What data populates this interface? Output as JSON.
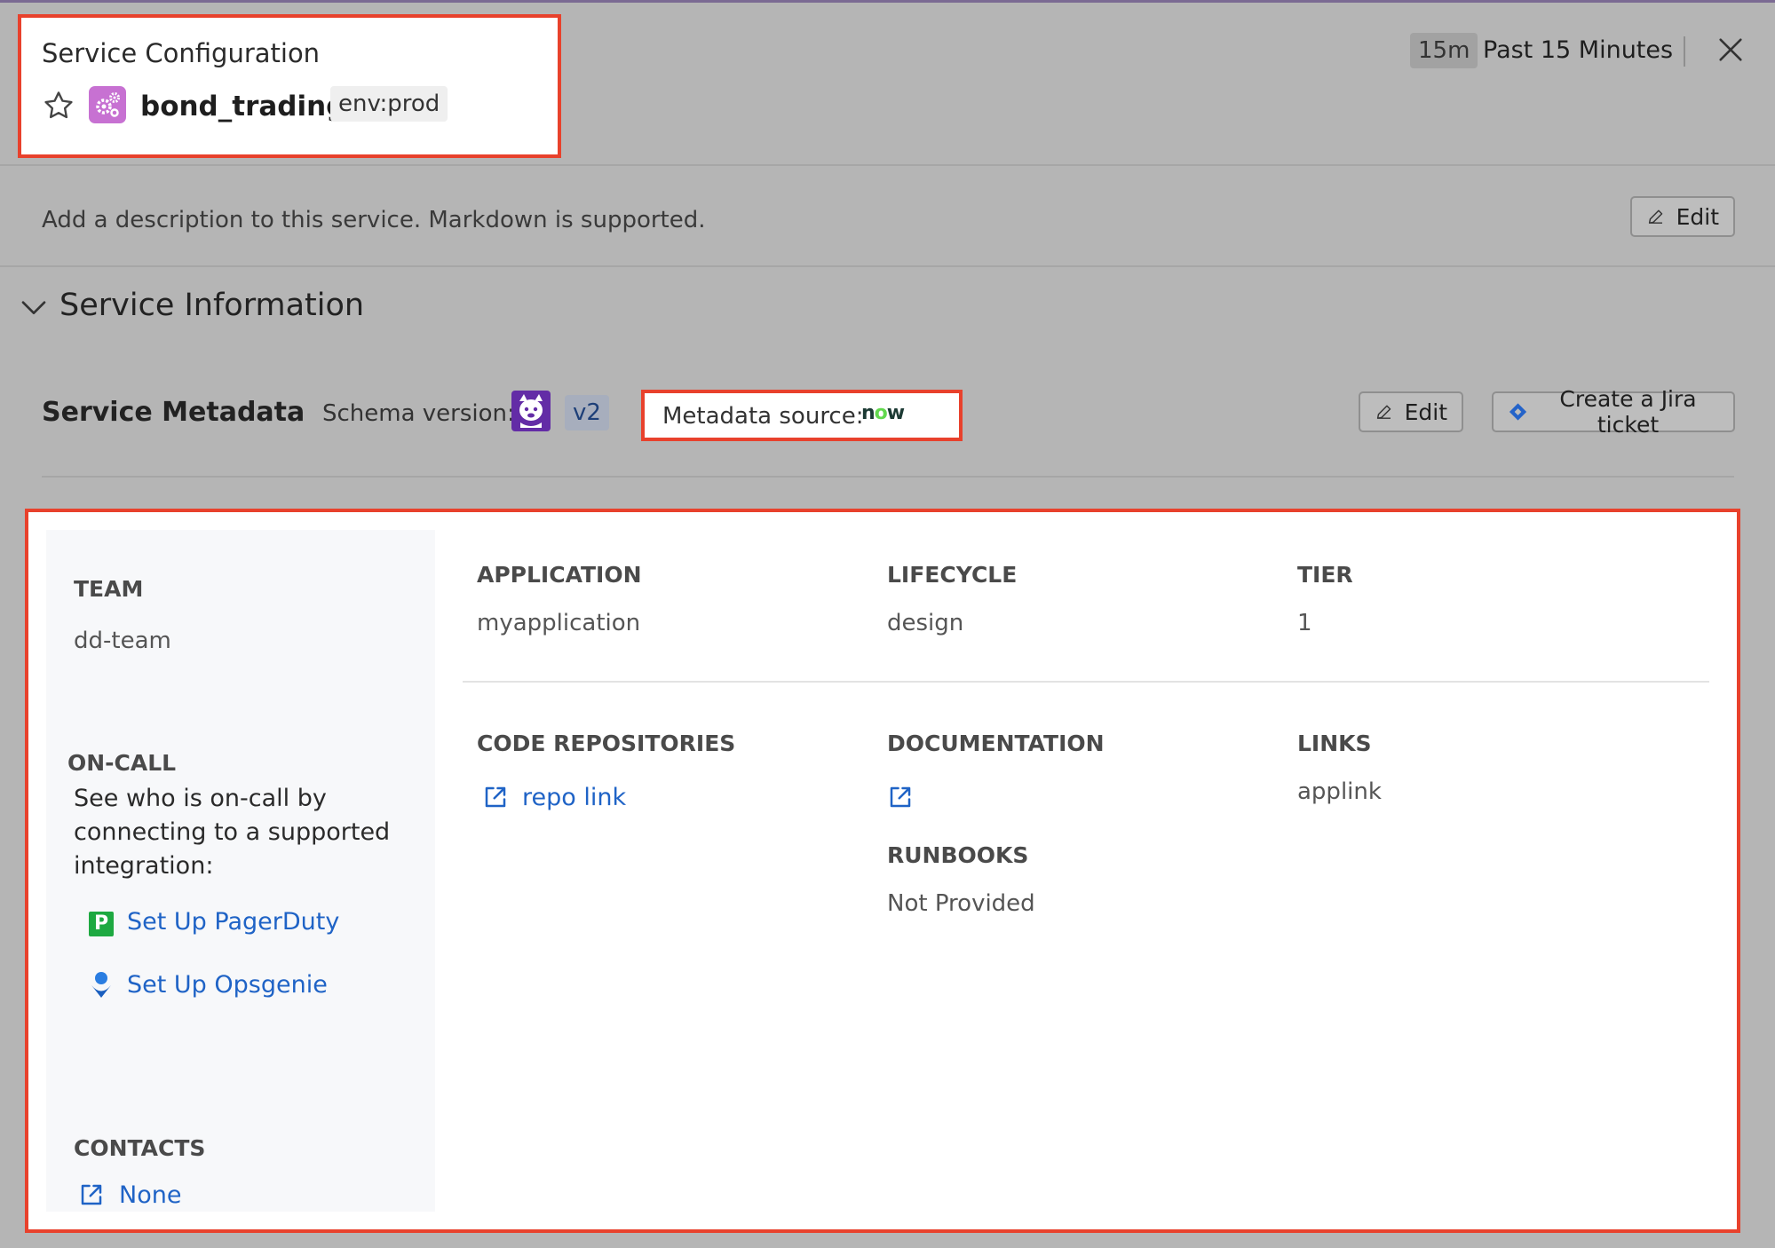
{
  "header": {
    "title": "Service Configuration",
    "service_name": "bond_trading",
    "env_tag": "env:prod",
    "time_badge": "15m",
    "time_label": "Past 15 Minutes"
  },
  "description": {
    "placeholder": "Add a description to this service. Markdown is supported.",
    "edit_label": "Edit"
  },
  "service_information": {
    "title": "Service Information",
    "metadata": {
      "label": "Service Metadata",
      "schema_label": "Schema version:",
      "schema_version": "v2",
      "source_label": "Metadata source:",
      "source_logo": "now",
      "edit_label": "Edit",
      "jira_label": "Create a Jira ticket"
    }
  },
  "panel": {
    "team": {
      "label": "TEAM",
      "value": "dd-team"
    },
    "oncall": {
      "label": "ON-CALL",
      "text": "See who is on-call by connecting to a supported integration:",
      "pagerduty_label": "Set Up PagerDuty",
      "opsgenie_label": "Set Up Opsgenie"
    },
    "contacts": {
      "label": "CONTACTS",
      "value": "None"
    },
    "application": {
      "label": "APPLICATION",
      "value": "myapplication"
    },
    "lifecycle": {
      "label": "LIFECYCLE",
      "value": "design"
    },
    "tier": {
      "label": "TIER",
      "value": "1"
    },
    "code_repositories": {
      "label": "CODE REPOSITORIES",
      "value": "repo link"
    },
    "documentation": {
      "label": "DOCUMENTATION"
    },
    "runbooks": {
      "label": "RUNBOOKS",
      "value": "Not Provided"
    },
    "links": {
      "label": "LINKS",
      "value": "applink"
    }
  },
  "colors": {
    "highlight": "#e8412c",
    "link": "#1f63c6",
    "overlay": "#b5b5b5"
  }
}
